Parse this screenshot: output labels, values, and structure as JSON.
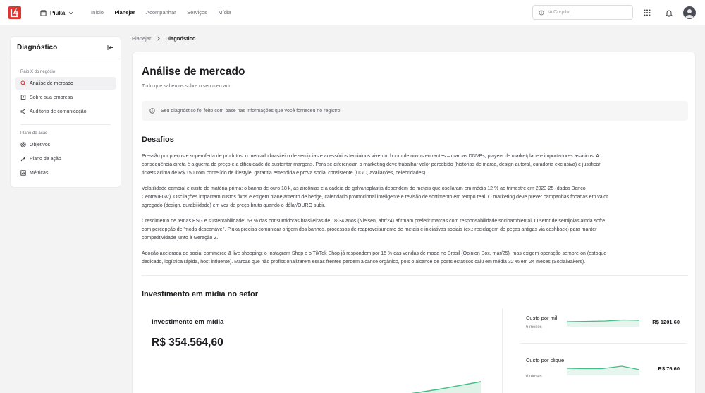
{
  "app": {
    "workspace": "Piuka",
    "nav": [
      "Início",
      "Planejar",
      "Acompanhar",
      "Serviços",
      "Mídia"
    ],
    "nav_active": "Planejar",
    "search_placeholder": "IA Co-pilot"
  },
  "sidebar": {
    "title": "Diagnóstico",
    "section1": "Raio X do negócio",
    "items1": [
      "Análise de mercado",
      "Sobre sua empresa",
      "Auditoria de comunicação"
    ],
    "section2": "Plano de ação",
    "items2": [
      "Objetivos",
      "Plano de ação",
      "Métricas"
    ]
  },
  "breadcrumb": {
    "parent": "Planejar",
    "current": "Diagnóstico"
  },
  "page": {
    "title": "Análise de mercado",
    "subtitle": "Tudo que sabemos sobre o seu mercado",
    "info": "Seu diagnóstico foi feito com base nas informações que você forneceu no registro",
    "challenges_title": "Desafios",
    "paragraphs": [
      [
        "Pressão por preços e superoferta de produtos: o mercado brasileiro de semijoias e acessórios femininos vive um boom de novos entrantes – marcas DNVBs, players de marketplace e importadores asiáticos. A",
        "consequência direta é a guerra de preço e a dificuldade de sustentar margens. Para se diferenciar, o marketing deve trabalhar valor percebido (histórias de marca, design autoral, curadoria exclusiva) e justificar",
        "tickets acima de R$ 150 com conteúdo de lifestyle, garantia estendida e prova social consistente (UGC, avaliações, celebridades)."
      ],
      [
        "Volatilidade cambial e custo de matéria-prima: o banho de ouro 18 k, as zircônias e a cadeia de galvanoplastia dependem de metais que oscilaram em média 12 % ao trimestre em 2023-25 (dados Banco",
        "Central/FGV). Oscilações impactam custos fixos e exigem planejamento de hedge, calendário promocional inteligente e revisão de sortimento em tempo real. O marketing deve prever campanhas focadas em valor",
        "agregado (design, durabilidade) em vez de preço bruto quando o dólar/OURO subir."
      ],
      [
        "Crescimento de temas ESG e sustentabilidade: 63 % das consumidoras brasileiras de 18-34 anos (Nielsen, abr/24) afirmam preferir marcas com responsabilidade socioambiental. O setor de semijoias ainda sofre",
        "com percepção de 'moda descartável'. Piuka precisa comunicar origem dos banhos, processos de reaproveitamento de metais e iniciativas sociais (ex.: reciclagem de peças antigas via cashback) para manter",
        "competitividade junto à Geração Z."
      ],
      [
        "Adoção acelerada de social commerce & live shopping: o Instagram Shop e o TikTok Shop já respondem por 15 % das vendas de moda no Brasil (Opinion Box, mar/25), mas exigem operação sempre-on (estoque",
        "dedicado, logística rápida, host influente). Marcas que não profissionalizarem essas frentes perdem alcance orgânico, pois o alcance de posts estáticos caiu em média 32 % em 24 meses (SocialBakers)."
      ]
    ],
    "investment_title": "Investimento em mídia no setor",
    "investment_label": "Investimento em mídia",
    "investment_value": "R$ 354.564,60",
    "metrics": [
      {
        "title": "Custo por mil",
        "period": "6 meses",
        "value": "R$ 1201.60"
      },
      {
        "title": "Custo por clique",
        "period": "6 meses",
        "value": "R$ 76.60"
      }
    ]
  },
  "colors": {
    "accent": "#3fbf86",
    "brand": "#e3342f"
  }
}
